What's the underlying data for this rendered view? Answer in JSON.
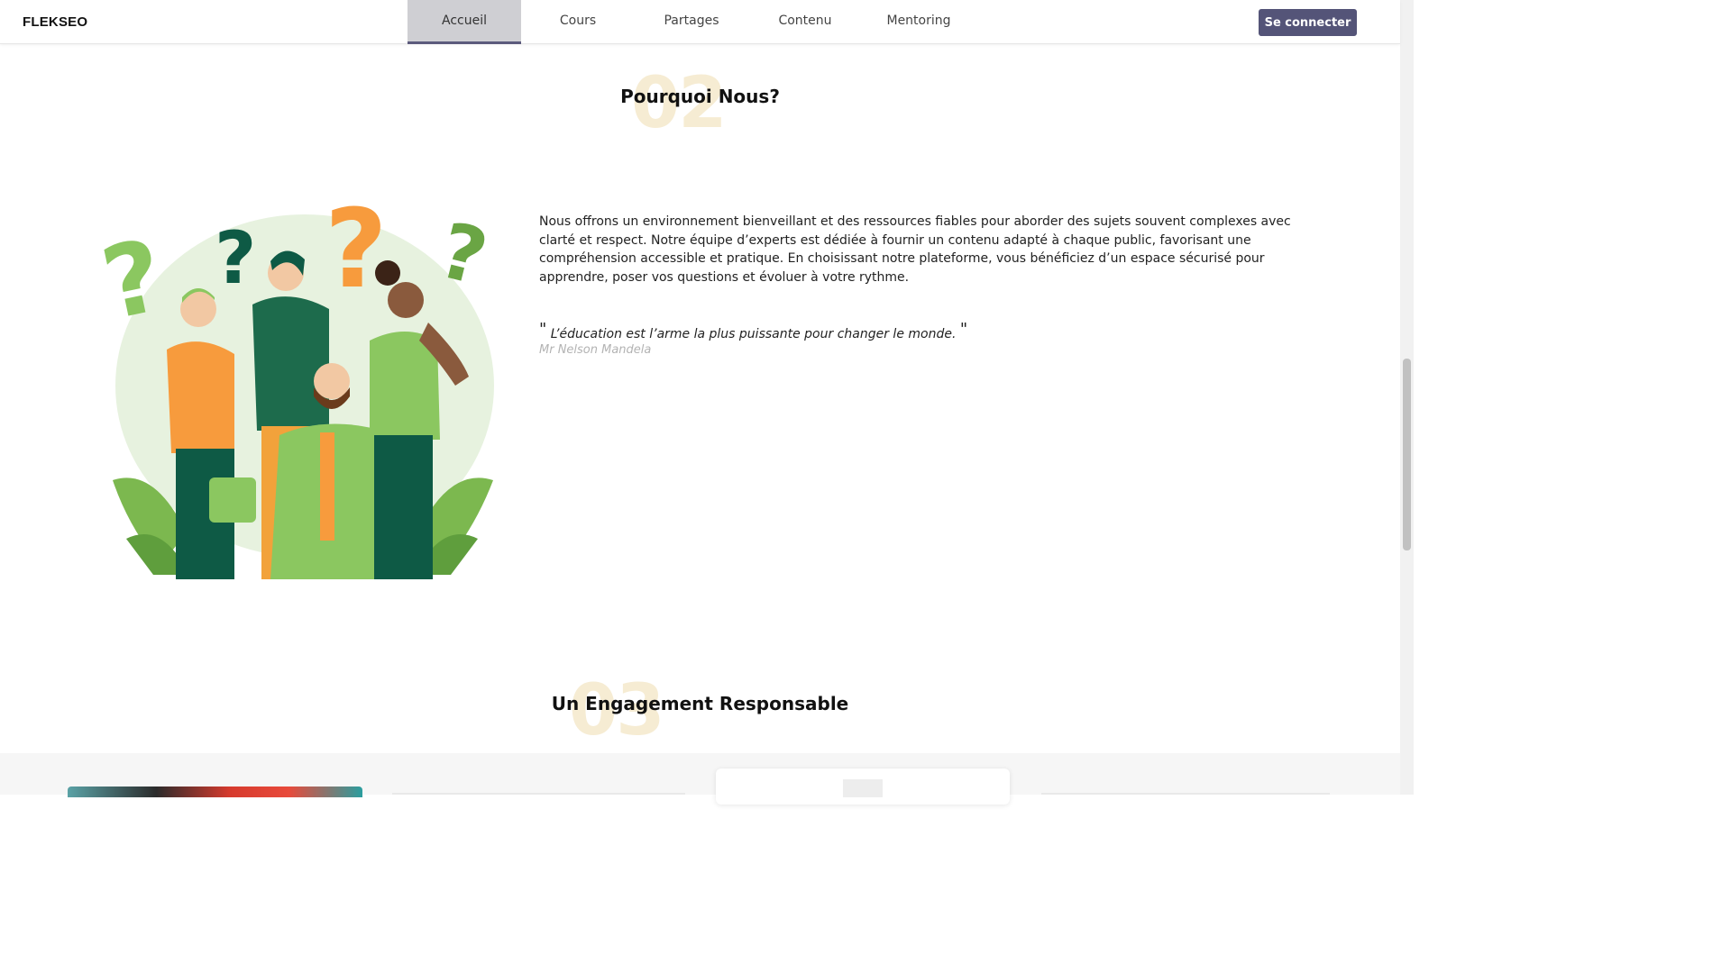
{
  "header": {
    "logo": "FLEKSEO",
    "nav": [
      {
        "label": "Accueil",
        "active": true
      },
      {
        "label": "Cours",
        "active": false
      },
      {
        "label": "Partages",
        "active": false
      },
      {
        "label": "Contenu",
        "active": false
      },
      {
        "label": "Mentoring",
        "active": false
      }
    ],
    "login_label": "Se connecter"
  },
  "why": {
    "number": "02",
    "title": "Pourquoi Nous?",
    "paragraph": "Nous offrons un environnement bienveillant et des ressources fiables pour aborder des sujets souvent complexes avec clarté et respect. Notre équipe d’experts est dédiée à fournir un contenu adapté à chaque public, favorisant une compréhension accessible et pratique. En choisissant notre plateforme, vous bénéficiez d’un espace sécurisé pour apprendre, poser vos questions et évoluer à votre rythme.",
    "quote": "L’éducation est l’arme la plus puissante pour changer le monde.",
    "quote_open": "\"",
    "quote_close": "\"",
    "author": "Mr Nelson Mandela"
  },
  "engagement": {
    "number": "03",
    "title": "Un Engagement Responsable"
  },
  "colors": {
    "accent": "#545478",
    "number_tint": "#f6ecd3",
    "green_light": "#8bc760",
    "green_dark": "#0e5a45",
    "orange": "#f79b3d"
  }
}
